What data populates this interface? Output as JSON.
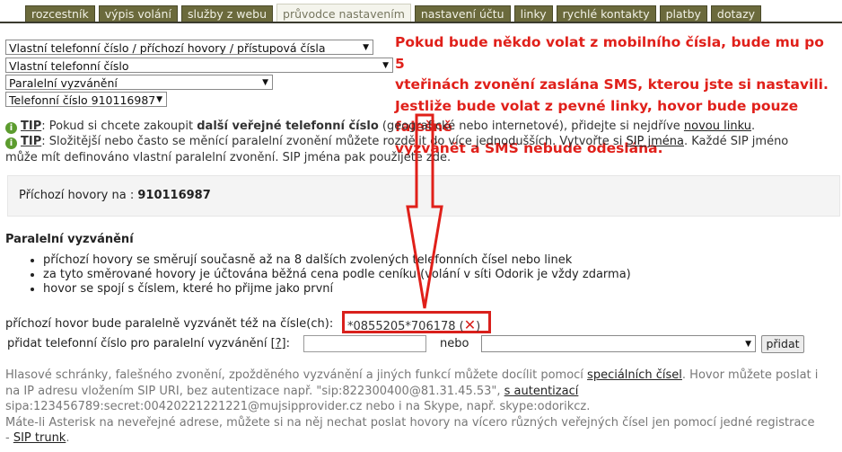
{
  "tabs": [
    {
      "label": "rozcestník",
      "active": false
    },
    {
      "label": "výpis volání",
      "active": false
    },
    {
      "label": "služby z webu",
      "active": false
    },
    {
      "label": "průvodce nastavením",
      "active": true
    },
    {
      "label": "nastavení účtu",
      "active": false
    },
    {
      "label": "linky",
      "active": false
    },
    {
      "label": "rychlé kontakty",
      "active": false
    },
    {
      "label": "platby",
      "active": false
    },
    {
      "label": "dotazy",
      "active": false
    }
  ],
  "selects": {
    "category": "Vlastní telefonní číslo / příchozí hovory / přístupová čísla",
    "sub": "Vlastní telefonní číslo",
    "feature": "Paralelní vyzvánění",
    "number": "Telefonní číslo 910116987"
  },
  "annotation": {
    "line1": "Pokud bude někdo volat z mobilního čísla, bude mu po 5",
    "line2": "vteřinách zvonění zaslána SMS, kterou jste si nastavili.",
    "line3": "Jestliže bude volat z pevné linky, hovor bude pouze falešně",
    "line4": "vyzvánět a SMS nebude odeslána."
  },
  "tip1": {
    "tag": "TIP",
    "pre": ": Pokud si chcete zakoupit ",
    "bold": "další veřejné telefonní číslo",
    "mid": " (geografické nebo internetové), přidejte si nejdříve ",
    "link": "novou linku",
    "post": "."
  },
  "tip2": {
    "tag": "TIP",
    "pre": ": Složitější nebo často se měnící paralelní zvonění můžete rozdělit do více jednodušších. Vytvořte si ",
    "link": "SIP jména",
    "post": ". Každé SIP jméno",
    "line2": "může mít definováno vlastní paralelní zvonění. SIP jména pak použijete zde."
  },
  "incoming": {
    "label": "Příchozí hovory na :",
    "number": "910116987"
  },
  "section_title": "Paralelní vyzvánění",
  "bullets": [
    "příchozí hovory se směrují současně až na 8 dalších zvolených telefonních čísel nebo linek",
    "za tyto směrované hovory je účtována běžná cena podle ceníku (volání v síti Odorik je vždy zdarma)",
    "hovor se spojí s číslem, které ho přijme jako první"
  ],
  "parallel": {
    "label": "příchozí hovor bude paralelně vyzvánět též na čísle(ch):",
    "value": "*0855205*706178 (",
    "close": ")"
  },
  "add": {
    "label": "přidat telefonní číslo pro paralelní vyzvánění [",
    "help": "?",
    "label_end": "]:",
    "or": "nebo",
    "button": "přidat"
  },
  "footer": {
    "p1": "Hlasové schránky, falešného zvonění, zpožděného vyzvánění a jiných funkcí můžete docílit pomocí ",
    "link1": "speciálních čísel",
    "p2": ". Hovor můžete poslat i",
    "line2": "na IP adresu vložením SIP URI, bez autentizace např. \"sip:822300400@81.31.45.53\", ",
    "link2": "s autentizací",
    "line3": "sipa:123456789:secret:00420221221221@mujsipprovider.cz nebo i na Skype, např. skype:odorikcz.",
    "line4": "Máte-li Asterisk na neveřejné adrese, můžete si na něj nechat poslat hovory na vícero různých veřejných čísel jen pomocí jedné registrace",
    "line5pre": "- ",
    "link3": "SIP trunk",
    "line5post": "."
  },
  "colors": {
    "tab": "#6b6a3c",
    "accent": "#e0201a",
    "tip": "#5c9c2e"
  }
}
